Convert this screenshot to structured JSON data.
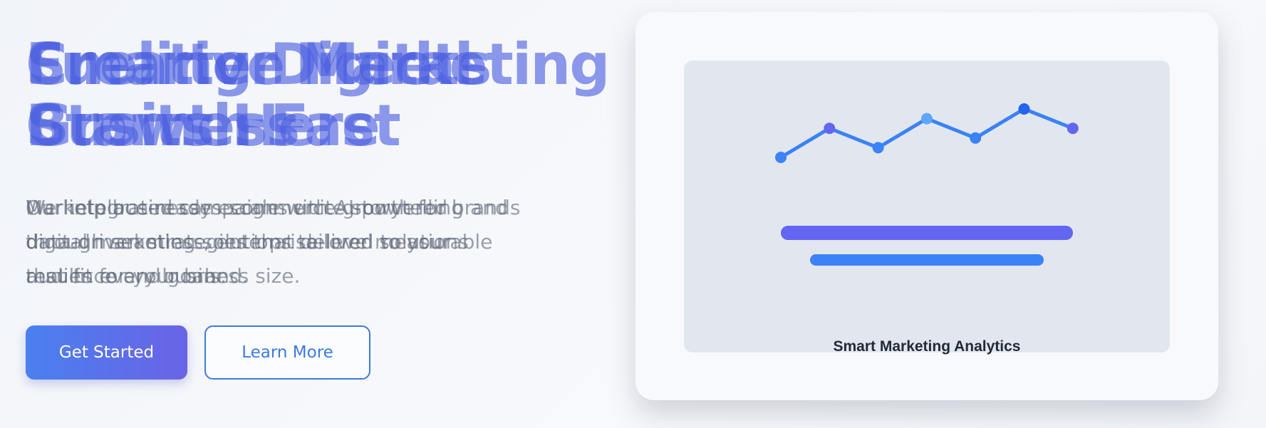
{
  "hero": {
    "headline_layers": [
      {
        "line1": "Smarter Marketing",
        "line2": "Starts Here"
      },
      {
        "line1": "Creative Meets",
        "line2": "Business"
      },
      {
        "line1": "Fueling Digital",
        "line2": "Growth Fast"
      }
    ],
    "description_layers": [
      {
        "line1": "Our integrated campaigns unite storytelling and",
        "line2": "data-driven strategies that deliver measurable",
        "line3": "results for your brand."
      },
      {
        "line1": "We help businesses scale with AI-powered",
        "line2": "digital marketing solutions tailored to your",
        "line3": "audience and goals."
      },
      {
        "line1": "Marketplace-ready ecommerce growth for brands",
        "line2": "through seamless, enterprise-level solutions",
        "line3": "that fit every business size."
      }
    ],
    "primary_button": "Get Started",
    "secondary_button": "Learn More"
  },
  "illustration": {
    "caption": "Smart Marketing Analytics",
    "trend_values": [
      3,
      6,
      4,
      7,
      5,
      8,
      6
    ],
    "point_colors": [
      "#3b82f6",
      "#6366f1",
      "#3b82f6",
      "#60a5fa",
      "#3b82f6",
      "#2563eb",
      "#6366f1"
    ],
    "line_color": "#3b82f6",
    "bar_colors": [
      "#6366f1",
      "#3b82f6"
    ]
  }
}
